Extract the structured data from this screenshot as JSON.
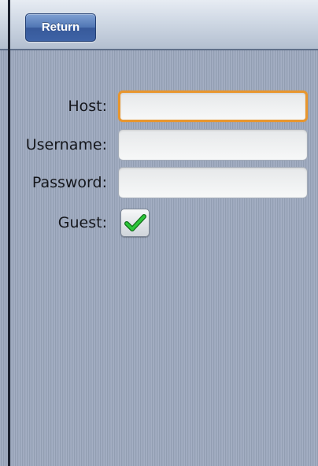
{
  "header": {
    "return_label": "Return"
  },
  "form": {
    "host": {
      "label": "Host:",
      "value": "",
      "focused": true
    },
    "username": {
      "label": "Username:",
      "value": ""
    },
    "password": {
      "label": "Password:",
      "value": ""
    },
    "guest": {
      "label": "Guest:",
      "checked": true
    }
  },
  "icons": {
    "checkbox_mark": "checkmark-icon"
  },
  "colors": {
    "focus_border": "#e8962e",
    "return_button": "#3e63a6",
    "checkmark": "#1fa82a",
    "background": "#9aa6bc"
  }
}
